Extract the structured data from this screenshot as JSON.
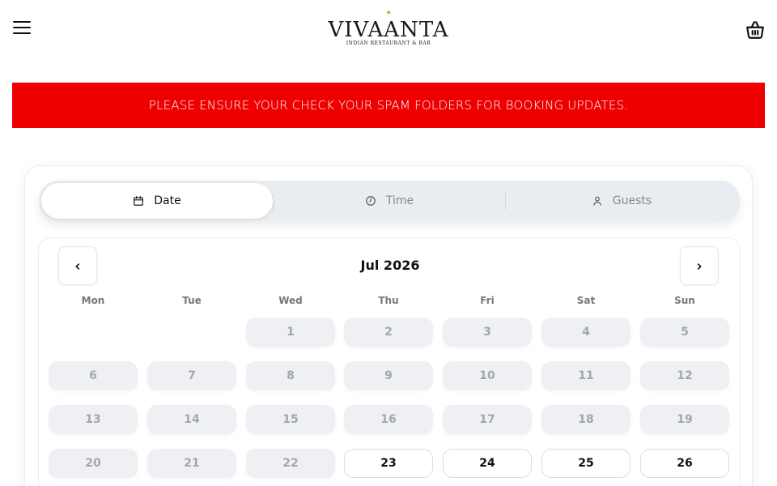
{
  "header": {
    "brand_name": "VIVAANTA",
    "brand_tagline": "INDIAN RESTAURANT & BAR",
    "menu_icon": "hamburger-menu-icon",
    "cart_icon": "basket-icon"
  },
  "banner": {
    "text": "PLEASE ENSURE YOUR CHECK YOUR SPAM FOLDERS FOR BOOKING UPDATES.",
    "color": "#ee0000"
  },
  "tabs": [
    {
      "label": "Date",
      "icon": "calendar-icon",
      "active": true
    },
    {
      "label": "Time",
      "icon": "clock-icon",
      "active": false
    },
    {
      "label": "Guests",
      "icon": "user-icon",
      "active": false
    }
  ],
  "calendar": {
    "month_label": "Jul 2026",
    "prev_icon": "chevron-left-icon",
    "next_icon": "chevron-right-icon",
    "weekdays": [
      "Mon",
      "Tue",
      "Wed",
      "Thu",
      "Fri",
      "Sat",
      "Sun"
    ],
    "weeks": [
      [
        null,
        null,
        {
          "d": "1",
          "available": false
        },
        {
          "d": "2",
          "available": false
        },
        {
          "d": "3",
          "available": false
        },
        {
          "d": "4",
          "available": false
        },
        {
          "d": "5",
          "available": false
        }
      ],
      [
        {
          "d": "6",
          "available": false
        },
        {
          "d": "7",
          "available": false
        },
        {
          "d": "8",
          "available": false
        },
        {
          "d": "9",
          "available": false
        },
        {
          "d": "10",
          "available": false
        },
        {
          "d": "11",
          "available": false
        },
        {
          "d": "12",
          "available": false
        }
      ],
      [
        {
          "d": "13",
          "available": false
        },
        {
          "d": "14",
          "available": false
        },
        {
          "d": "15",
          "available": false
        },
        {
          "d": "16",
          "available": false
        },
        {
          "d": "17",
          "available": false
        },
        {
          "d": "18",
          "available": false
        },
        {
          "d": "19",
          "available": false
        }
      ],
      [
        {
          "d": "20",
          "available": false
        },
        {
          "d": "21",
          "available": false
        },
        {
          "d": "22",
          "available": false
        },
        {
          "d": "23",
          "available": true
        },
        {
          "d": "24",
          "available": true
        },
        {
          "d": "25",
          "available": true
        },
        {
          "d": "26",
          "available": true
        }
      ]
    ]
  }
}
